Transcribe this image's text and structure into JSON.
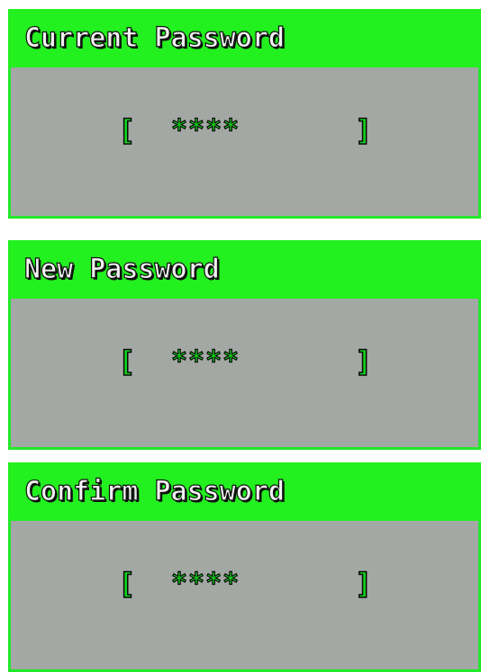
{
  "panels": {
    "current": {
      "title": "Current Password",
      "bracket_open": "[",
      "masked_value": "****",
      "bracket_close": "]"
    },
    "new": {
      "title": "New Password",
      "bracket_open": "[",
      "masked_value": "****",
      "bracket_close": "]"
    },
    "confirm": {
      "title": "Confirm Password",
      "bracket_open": "[",
      "masked_value": "****",
      "bracket_close": "]"
    }
  },
  "colors": {
    "header_green": "#22f01f",
    "panel_gray": "#a3a8a4",
    "field_green": "#15d01c"
  }
}
